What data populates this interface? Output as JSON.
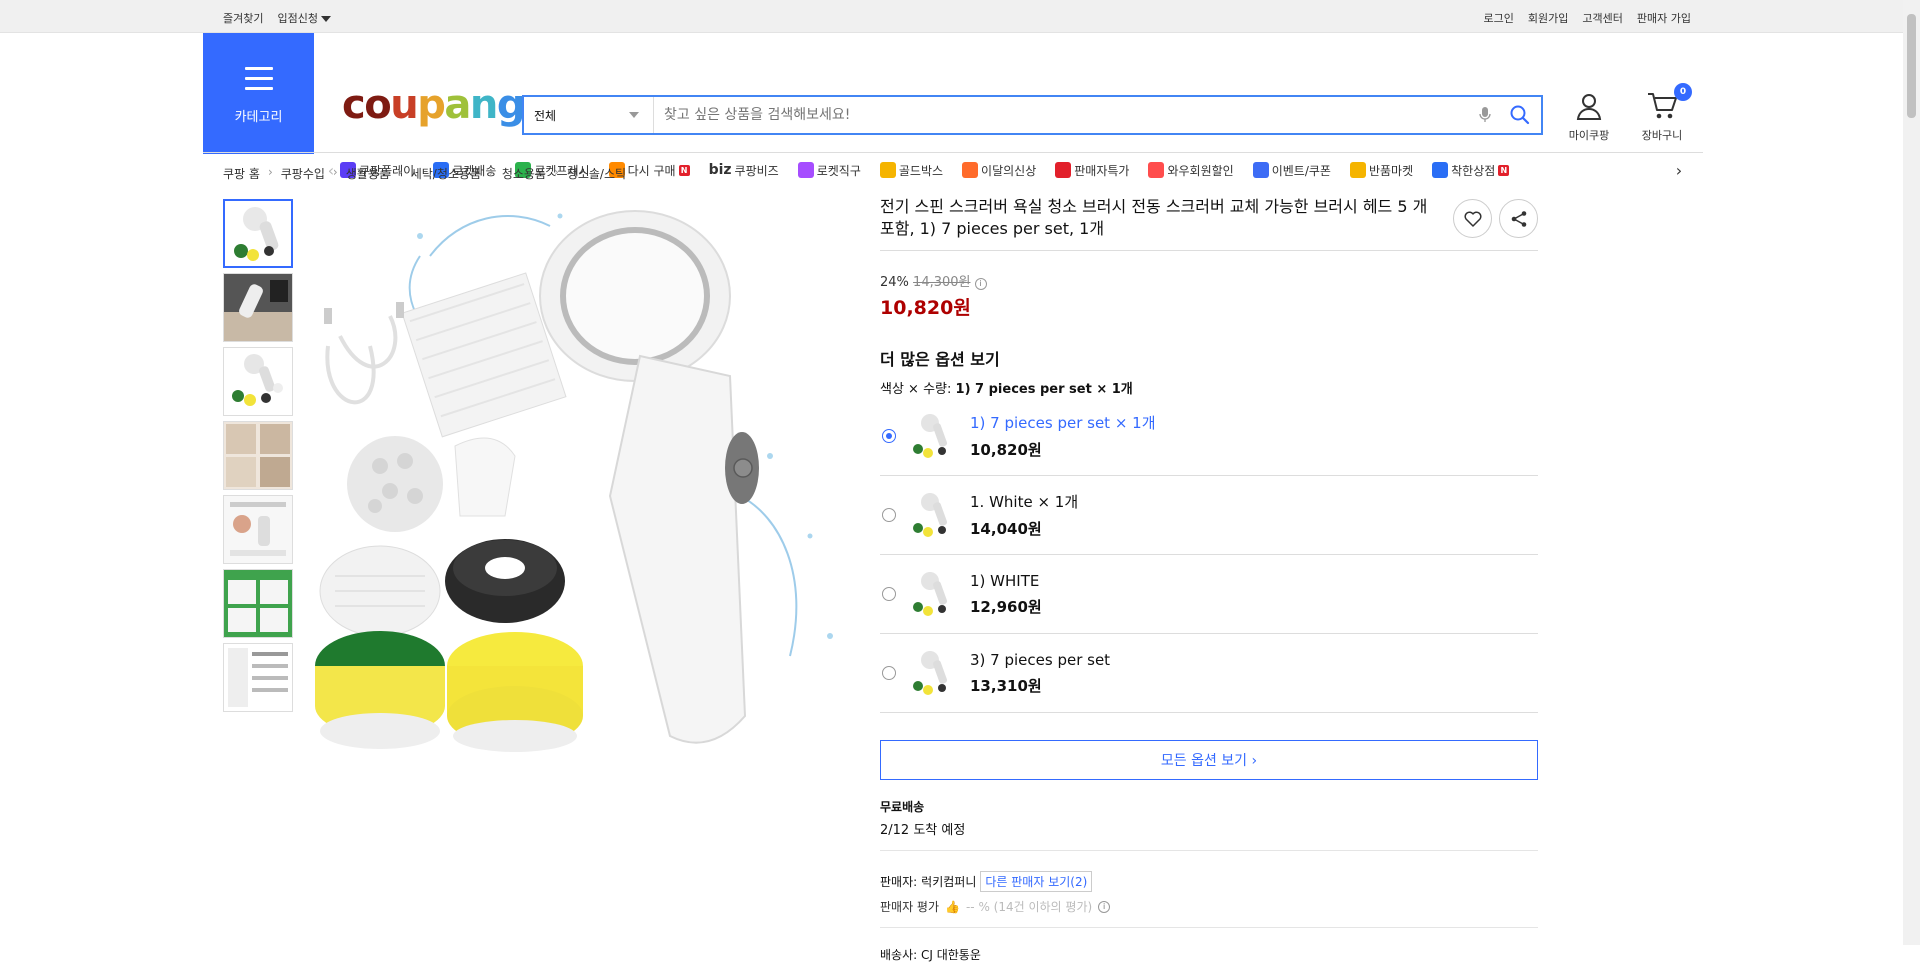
{
  "topbar": {
    "bookmark": "즐겨찾기",
    "join_seller": "입점신청",
    "login": "로그인",
    "signup": "회원가입",
    "cs": "고객센터",
    "seller_signup": "판매자 가입"
  },
  "header": {
    "category": "카테고리",
    "logo": "coupang",
    "search_scope": "전체",
    "search_placeholder": "찾고 싶은 상품을 검색해보세요!",
    "mycoupang": "마이쿠팡",
    "cart": "장바구니",
    "cart_count": "0"
  },
  "nav": [
    {
      "label": "쿠팡플레이",
      "color": "#5b3df5"
    },
    {
      "label": "로켓배송",
      "color": "#2a6ef5"
    },
    {
      "label": "로켓프레시",
      "color": "#2bb24c"
    },
    {
      "label": "다시 구매",
      "color": "#ff8a00",
      "new": "N"
    },
    {
      "label": "쿠팡비즈",
      "prefix": "biz",
      "color": "#111"
    },
    {
      "label": "로켓직구",
      "color": "#a64dff"
    },
    {
      "label": "골드박스",
      "color": "#f5b400"
    },
    {
      "label": "이달의신상",
      "color": "#ff6b2b"
    },
    {
      "label": "판매자특가",
      "color": "#e2202b"
    },
    {
      "label": "와우회원할인",
      "color": "#ff4d4d"
    },
    {
      "label": "이벤트/쿠폰",
      "color": "#3d6cf5"
    },
    {
      "label": "반품마켓",
      "color": "#f5b400"
    },
    {
      "label": "착한상점",
      "color": "#2a6ef5",
      "new": "N"
    }
  ],
  "breadcrumb": [
    "쿠팡 홈",
    "쿠팡수입",
    "생활용품",
    "세탁/청소용품",
    "청소용품",
    "청소솔/스틱"
  ],
  "product": {
    "title": "전기 스핀 스크러버 욕실 청소 브러시 전동 스크러버 교체 가능한 브러시 헤드 5 개 포함, 1) 7 pieces per set, 1개",
    "discount_rate": "24%",
    "original_price": "14,300원",
    "price": "10,820원"
  },
  "options": {
    "heading": "더 많은 옵션 보기",
    "selected_label": "색상 × 수량:",
    "selected_value": "1) 7 pieces per set × 1개",
    "items": [
      {
        "name": "1) 7 pieces per set × 1개",
        "price": "10,820원",
        "selected": true
      },
      {
        "name": "1. White × 1개",
        "price": "14,040원",
        "selected": false
      },
      {
        "name": "1) WHITE",
        "price": "12,960원",
        "selected": false
      },
      {
        "name": "3) 7 pieces per set",
        "price": "13,310원",
        "selected": false
      }
    ],
    "all_button": "모든 옵션 보기 ›"
  },
  "shipping": {
    "label": "무료배송",
    "eta": "2/12 도착 예정"
  },
  "seller": {
    "label": "판매자:",
    "name": "럭키컴퍼니",
    "other": "다른 판매자 보기(2)",
    "rating_label": "판매자 평가",
    "rating_value": "-- % (14건 이하의 평가)"
  },
  "courier": "배송사:  CJ 대한통운",
  "colors": {
    "accent": "#346aff",
    "price": "#ae0000"
  }
}
